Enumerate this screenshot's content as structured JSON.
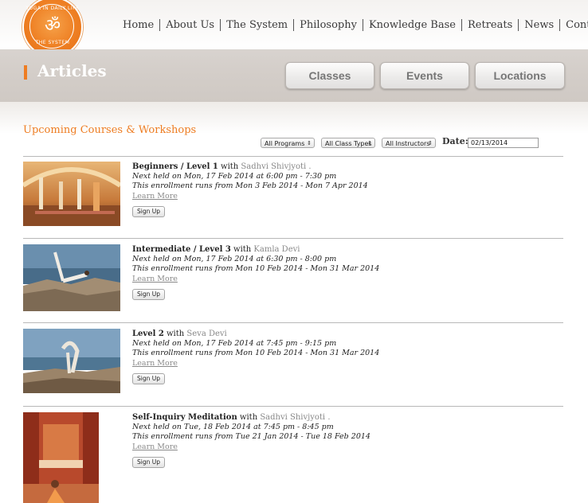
{
  "logo": {
    "top_text": "YOGA IN DAILY LIFE",
    "bottom_text": "THE SYSTEM",
    "symbol": "ॐ"
  },
  "nav": {
    "items": [
      "Home",
      "About Us",
      "The System",
      "Philosophy",
      "Knowledge Base",
      "Retreats",
      "News",
      "Contacts"
    ]
  },
  "banner": {
    "title": "Articles",
    "buttons": [
      "Classes",
      "Events",
      "Locations"
    ]
  },
  "section": {
    "title": "Upcoming Courses & Workshops"
  },
  "filters": {
    "program": "All Programs",
    "class_type": "All Class Types",
    "instructor": "All Instructors",
    "date_label": "Date:",
    "date_value": "02/13/2014"
  },
  "courses": [
    {
      "name": "Beginners / Level 1",
      "with": "with",
      "teacher": "Sadhvi Shivjyoti .",
      "next": "Next held on Mon, 17 Feb 2014 at 6:00 pm - 7:30 pm",
      "enrollment": "This enrollment runs from Mon 3 Feb 2014 - Mon 7 Apr 2014",
      "learn_more": "Learn More",
      "signup": "Sign Up"
    },
    {
      "name": "Intermediate / Level 3",
      "with": "with",
      "teacher": "Kamla Devi",
      "next": "Next held on Mon, 17 Feb 2014 at 6:30 pm - 8:00 pm",
      "enrollment": "This enrollment runs from Mon 10 Feb 2014 - Mon 31 Mar 2014",
      "learn_more": "Learn More",
      "signup": "Sign Up"
    },
    {
      "name": "Level 2",
      "with": "with",
      "teacher": "Seva Devi",
      "next": "Next held on Mon, 17 Feb 2014 at 7:45 pm - 9:15 pm",
      "enrollment": "This enrollment runs from Mon 10 Feb 2014 - Mon 31 Mar 2014",
      "learn_more": "Learn More",
      "signup": "Sign Up"
    },
    {
      "name": "Self-Inquiry Meditation",
      "with": "with",
      "teacher": "Sadhvi Shivjyoti .",
      "next": "Next held on Tue, 18 Feb 2014 at 7:45 pm - 8:45 pm",
      "enrollment": "This enrollment runs from Tue 21 Jan 2014 - Tue 18 Feb 2014",
      "learn_more": "Learn More",
      "signup": "Sign Up"
    }
  ],
  "colors": {
    "accent": "#ee7d22",
    "banner_bg": "#d3cdc8"
  }
}
